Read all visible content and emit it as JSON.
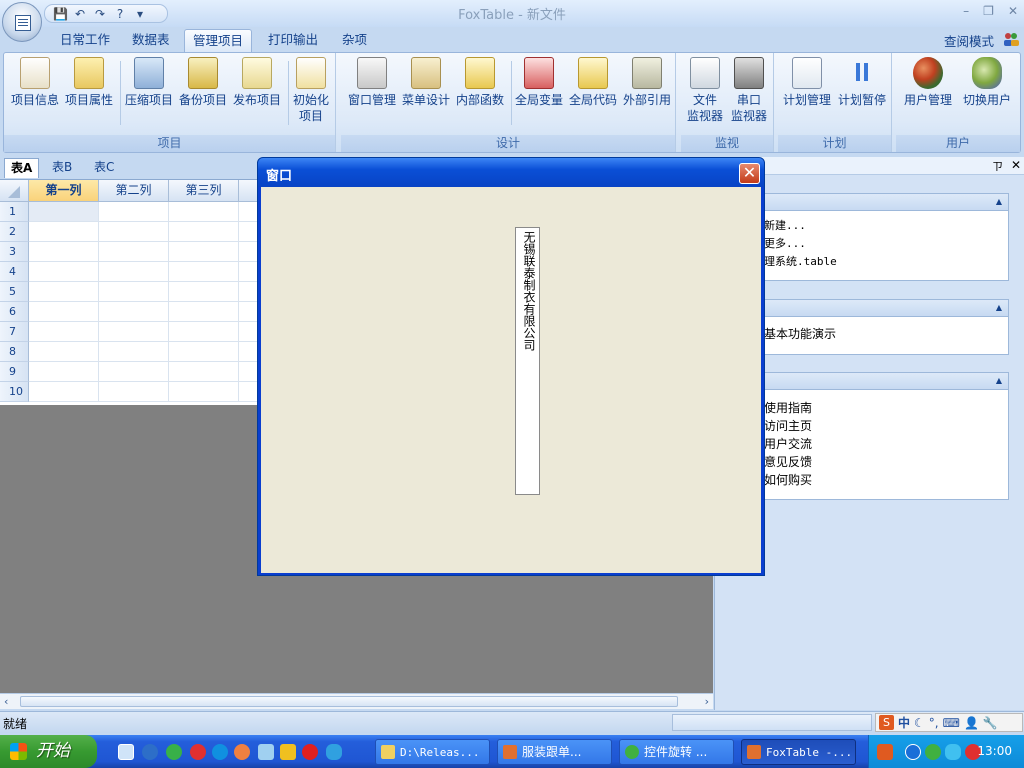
{
  "app": {
    "title": "FoxTable - 新文件",
    "view_mode": "查阅模式"
  },
  "ribbon_tabs": [
    {
      "label": "日常工作"
    },
    {
      "label": "数据表"
    },
    {
      "label": "管理项目",
      "active": true
    },
    {
      "label": "打印输出"
    },
    {
      "label": "杂项"
    }
  ],
  "groups": [
    {
      "label": "项目",
      "buttons": [
        "项目信息",
        "项目属性",
        "压缩项目",
        "备份项目",
        "发布项目",
        "初始化项目"
      ]
    },
    {
      "label": "设计",
      "buttons": [
        "窗口管理",
        "菜单设计",
        "内部函数",
        "全局变量",
        "全局代码",
        "外部引用"
      ]
    },
    {
      "label": "监视",
      "buttons": [
        "文件监视器",
        "串口监视器"
      ]
    },
    {
      "label": "计划",
      "buttons": [
        "计划管理",
        "计划暂停"
      ]
    },
    {
      "label": "用户",
      "buttons": [
        "用户管理",
        "切换用户"
      ]
    }
  ],
  "ribbon_labels": {
    "b0": "项目信息",
    "b1": "项目属性",
    "b2": "压缩项目",
    "b3": "备份项目",
    "b4": "发布项目",
    "b5a": "初始化",
    "b5b": "项目",
    "b6": "窗口管理",
    "b7": "菜单设计",
    "b8": "内部函数",
    "b9": "全局变量",
    "b10": "全局代码",
    "b11": "外部引用",
    "b12a": "文件",
    "b12b": "监视器",
    "b13a": "串口",
    "b13b": "监视器",
    "b14": "计划管理",
    "b15": "计划暂停",
    "b16": "用户管理",
    "b17": "切换用户",
    "g0": "项目",
    "g1": "设计",
    "g2": "监视",
    "g3": "计划",
    "g4": "用户"
  },
  "sheet_tabs": [
    "表A",
    "表B",
    "表C"
  ],
  "grid": {
    "columns": [
      "第一列",
      "第二列",
      "第三列"
    ],
    "rows": [
      "1",
      "2",
      "3",
      "4",
      "5",
      "6",
      "7",
      "8",
      "9",
      "10"
    ]
  },
  "task_pane": {
    "pin": "ㄗ",
    "close": "✕",
    "sec1": [
      "新建...",
      "更多...",
      "理系统.table"
    ],
    "sec2": [
      "基本功能演示"
    ],
    "sec3": [
      "使用指南",
      "访问主页",
      "用户交流",
      "意见反馈",
      "如何购买"
    ]
  },
  "dialog": {
    "title": "窗口",
    "close": "✕",
    "label_text": "无锡联泰制衣有限公司"
  },
  "status": {
    "text": "就绪"
  },
  "ime": {
    "mode": "中"
  },
  "taskbar": {
    "start": "开始",
    "tasks": [
      "D:\\Releas...",
      "服装跟单...",
      "控件旋转 ...",
      "FoxTable -..."
    ],
    "clock": "13:00"
  }
}
